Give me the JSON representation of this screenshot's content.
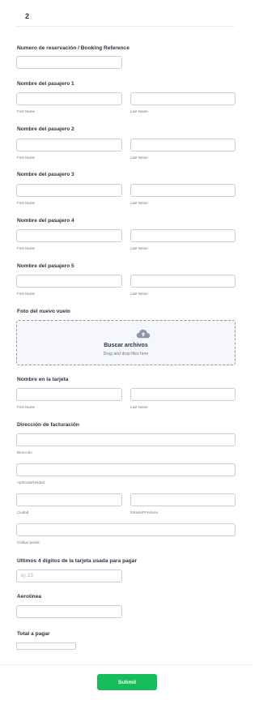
{
  "page_number": "2",
  "booking": {
    "label": "Numero de reservación / Booking Reference"
  },
  "passengers": [
    {
      "label": "Nombre del pasajero 1"
    },
    {
      "label": "Nombre del pasajero 2"
    },
    {
      "label": "Nombre del pasajero 3"
    },
    {
      "label": "Nombre del pasajero 4"
    },
    {
      "label": "Nombre del pasajero 5"
    }
  ],
  "name_sublabels": {
    "first": "First Name",
    "last": "Last Name"
  },
  "upload": {
    "label": "Foto del nuevo vuelo",
    "title": "Buscar archivos",
    "subtitle": "Drag and drop files here",
    "icon": "cloud-upload-icon"
  },
  "card_name": {
    "label": "Nombre en la tarjeta"
  },
  "billing": {
    "label": "Dirección de facturación",
    "address": "Dirección",
    "apt": "Apt/Casa/Unidad",
    "city": "Ciudad",
    "state": "Estado/Provincia",
    "postal": "Código postal"
  },
  "last_digits": {
    "label": "Ultimos 4 digitos de la tarjeta usada para pagar",
    "placeholder": "ej: 23"
  },
  "airline": {
    "label": "Aerolinea"
  },
  "total": {
    "label": "Total a pagar"
  },
  "submit": {
    "label": "Submit"
  },
  "colors": {
    "accent": "#18bd5b",
    "text": "#2c3345",
    "border": "#c9ced8",
    "upload_bg": "#f5f7fc"
  }
}
